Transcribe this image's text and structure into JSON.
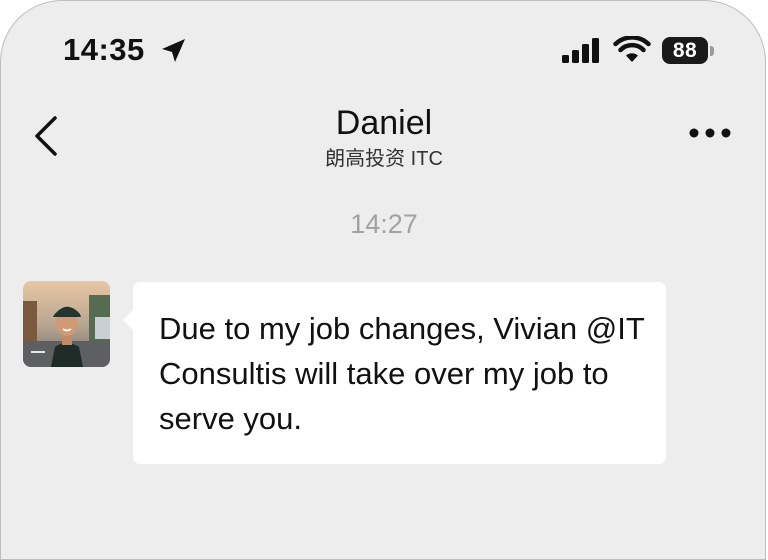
{
  "status_bar": {
    "time": "14:35",
    "battery": "88",
    "icons": [
      "location-arrow-icon",
      "cellular-signal-icon",
      "wifi-icon",
      "battery-icon"
    ]
  },
  "header": {
    "back_icon": "chevron-left-icon",
    "name": "Daniel",
    "company": "朗高投资 ITC",
    "more_icon": "ellipsis-icon"
  },
  "conversation": {
    "timestamp": "14:27",
    "messages": [
      {
        "sender": "Daniel",
        "avatar_icon": "user-photo-avatar",
        "text": "Due to my job changes, Vivian @IT Consultis will take over my job to serve you."
      }
    ]
  },
  "colors": {
    "background": "#ededed",
    "bubble": "#ffffff",
    "timestamp": "#a2a2a2",
    "text": "#111111"
  }
}
